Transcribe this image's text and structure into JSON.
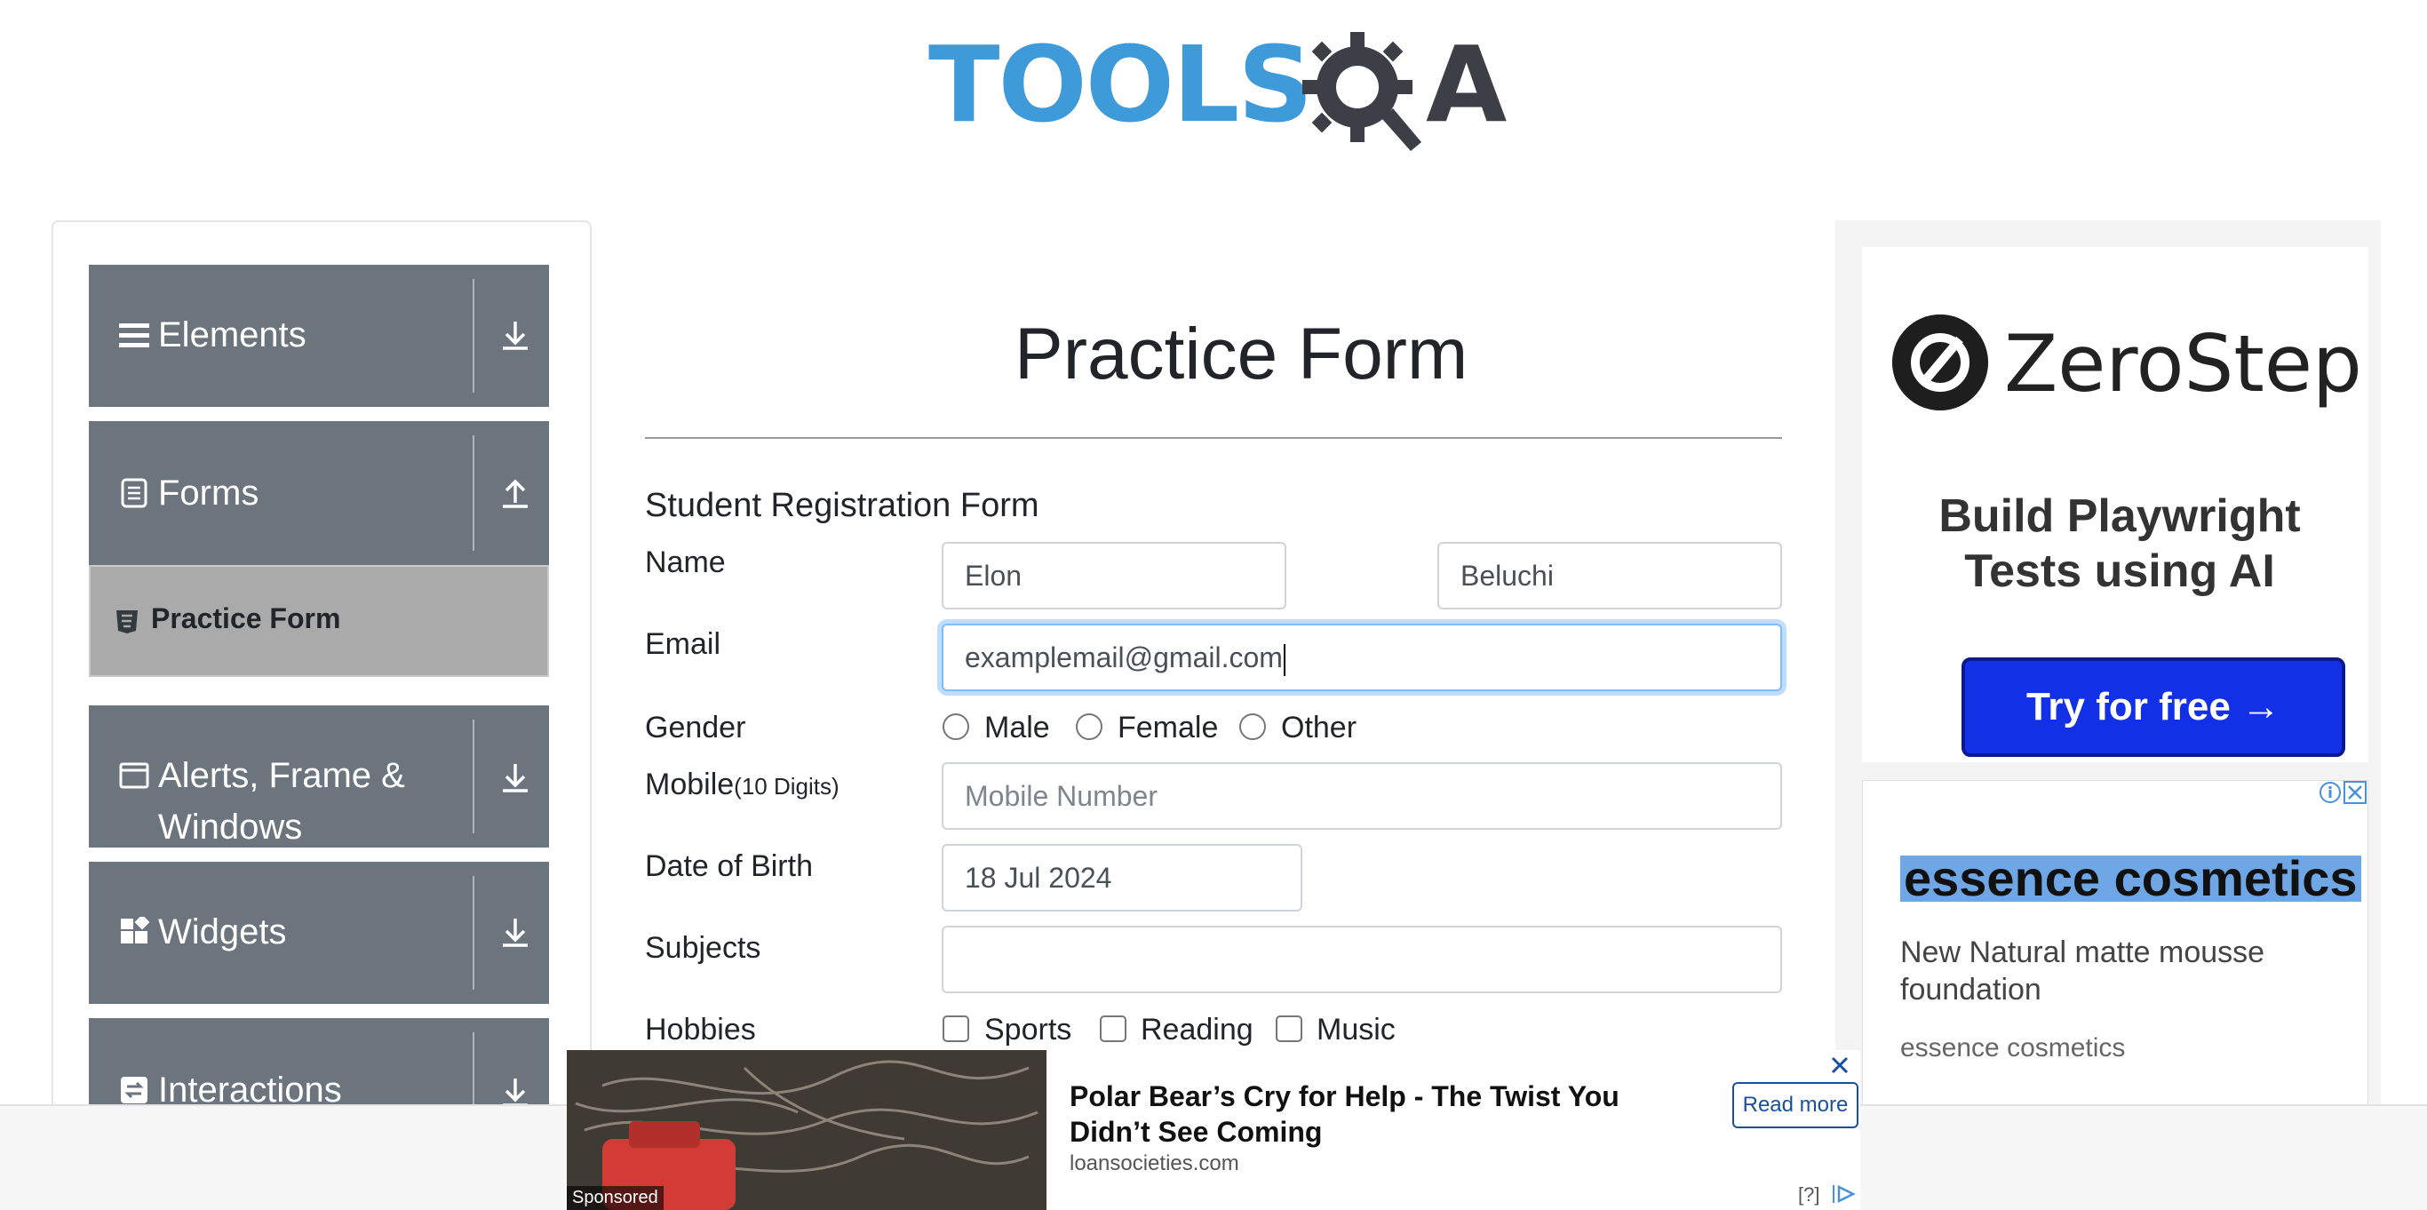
{
  "header": {
    "logo_part1": "TOOLS",
    "logo_part2": "A"
  },
  "sidebar": {
    "groups": [
      {
        "label": "Elements",
        "icon": "hamburger-icon",
        "arrow": "download-arrow-icon"
      },
      {
        "label": "Forms",
        "icon": "document-icon",
        "arrow": "upload-arrow-icon",
        "sub_items": [
          {
            "label": "Practice Form",
            "icon": "html5-icon"
          }
        ]
      },
      {
        "label_line1": "Alerts, Frame &",
        "label_line2": "Windows",
        "icon": "window-icon",
        "arrow": "download-arrow-icon"
      },
      {
        "label": "Widgets",
        "icon": "widgets-icon",
        "arrow": "download-arrow-icon"
      },
      {
        "label": "Interactions",
        "icon": "interactions-icon",
        "arrow": "download-arrow-icon"
      }
    ]
  },
  "main": {
    "title": "Practice Form",
    "form_title": "Student Registration Form",
    "name": {
      "label": "Name",
      "first_value": "Elon",
      "last_value": "Beluchi"
    },
    "email": {
      "label": "Email",
      "value": "examplemail@gmail.com"
    },
    "gender": {
      "label": "Gender",
      "options": [
        "Male",
        "Female",
        "Other"
      ]
    },
    "mobile": {
      "label": "Mobile",
      "label_hint": "(10 Digits)",
      "placeholder": "Mobile Number"
    },
    "dob": {
      "label": "Date of Birth",
      "value": "18 Jul 2024"
    },
    "subjects": {
      "label": "Subjects",
      "value": ""
    },
    "hobbies": {
      "label": "Hobbies",
      "options": [
        "Sports",
        "Reading",
        "Music"
      ]
    }
  },
  "ad_right": {
    "zerostep": {
      "brand": "ZeroStep",
      "headline": "Build Playwright Tests using AI",
      "cta": "Try for free →"
    },
    "essence": {
      "title": "essence cosmetics",
      "description": "New Natural matte mousse foundation",
      "source": "essence cosmetics"
    }
  },
  "ad_bottom": {
    "sponsored": "Sponsored",
    "headline": "Polar Bear’s Cry for Help - The Twist You Didn’t See Coming",
    "domain": "loansocieties.com",
    "cta": "Read more",
    "help": "[?]"
  },
  "colors": {
    "sidebar_group": "#6c757d",
    "active_item": "#aaaaaa",
    "accent_blue": "#3f9ad9",
    "cta_blue": "#1230e6"
  }
}
